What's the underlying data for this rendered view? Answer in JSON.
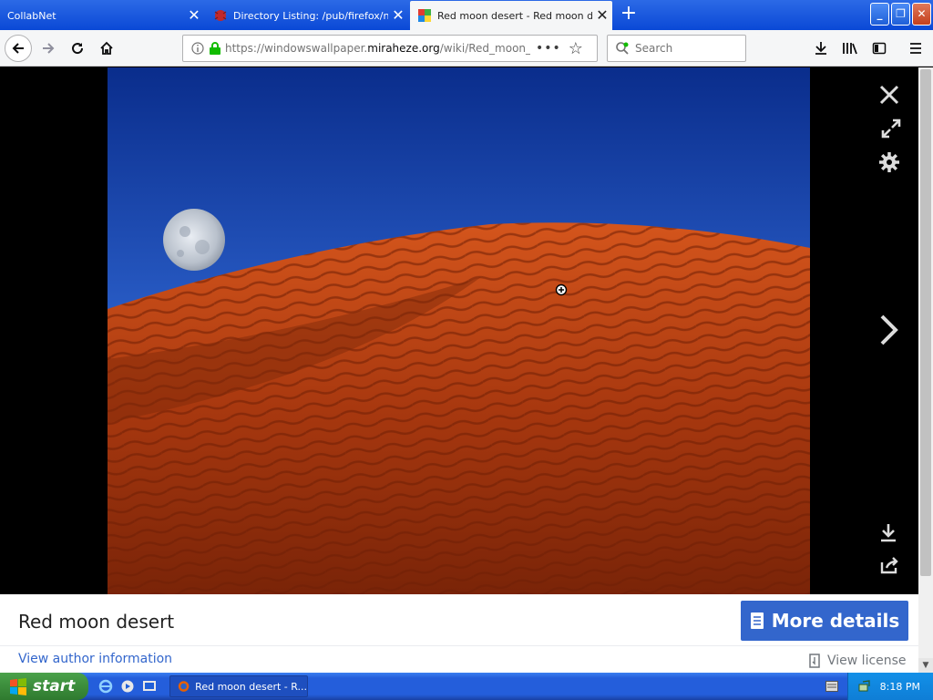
{
  "browser": {
    "tabs": [
      {
        "label": "CollabNet",
        "active": false
      },
      {
        "label": "Directory Listing: /pub/firefox/nightly/",
        "active": false
      },
      {
        "label": "Red moon desert - Red moon desert",
        "active": true
      }
    ],
    "url_prefix": "https://windowswallpaper.",
    "url_domain": "miraheze.org",
    "url_path": "/wiki/Red_moon_desert",
    "search_placeholder": "Search"
  },
  "lightbox": {
    "title": "Red moon desert",
    "more_details_label": "More details",
    "author_link": "View author information",
    "license_link": "View license"
  },
  "taskbar": {
    "start_label": "start",
    "task_label": "Red moon desert - R...",
    "clock": "8:18 PM"
  },
  "colors": {
    "accent": "#3366cc",
    "xp_blue": "#245edb",
    "start_green": "#3c8d3c"
  }
}
